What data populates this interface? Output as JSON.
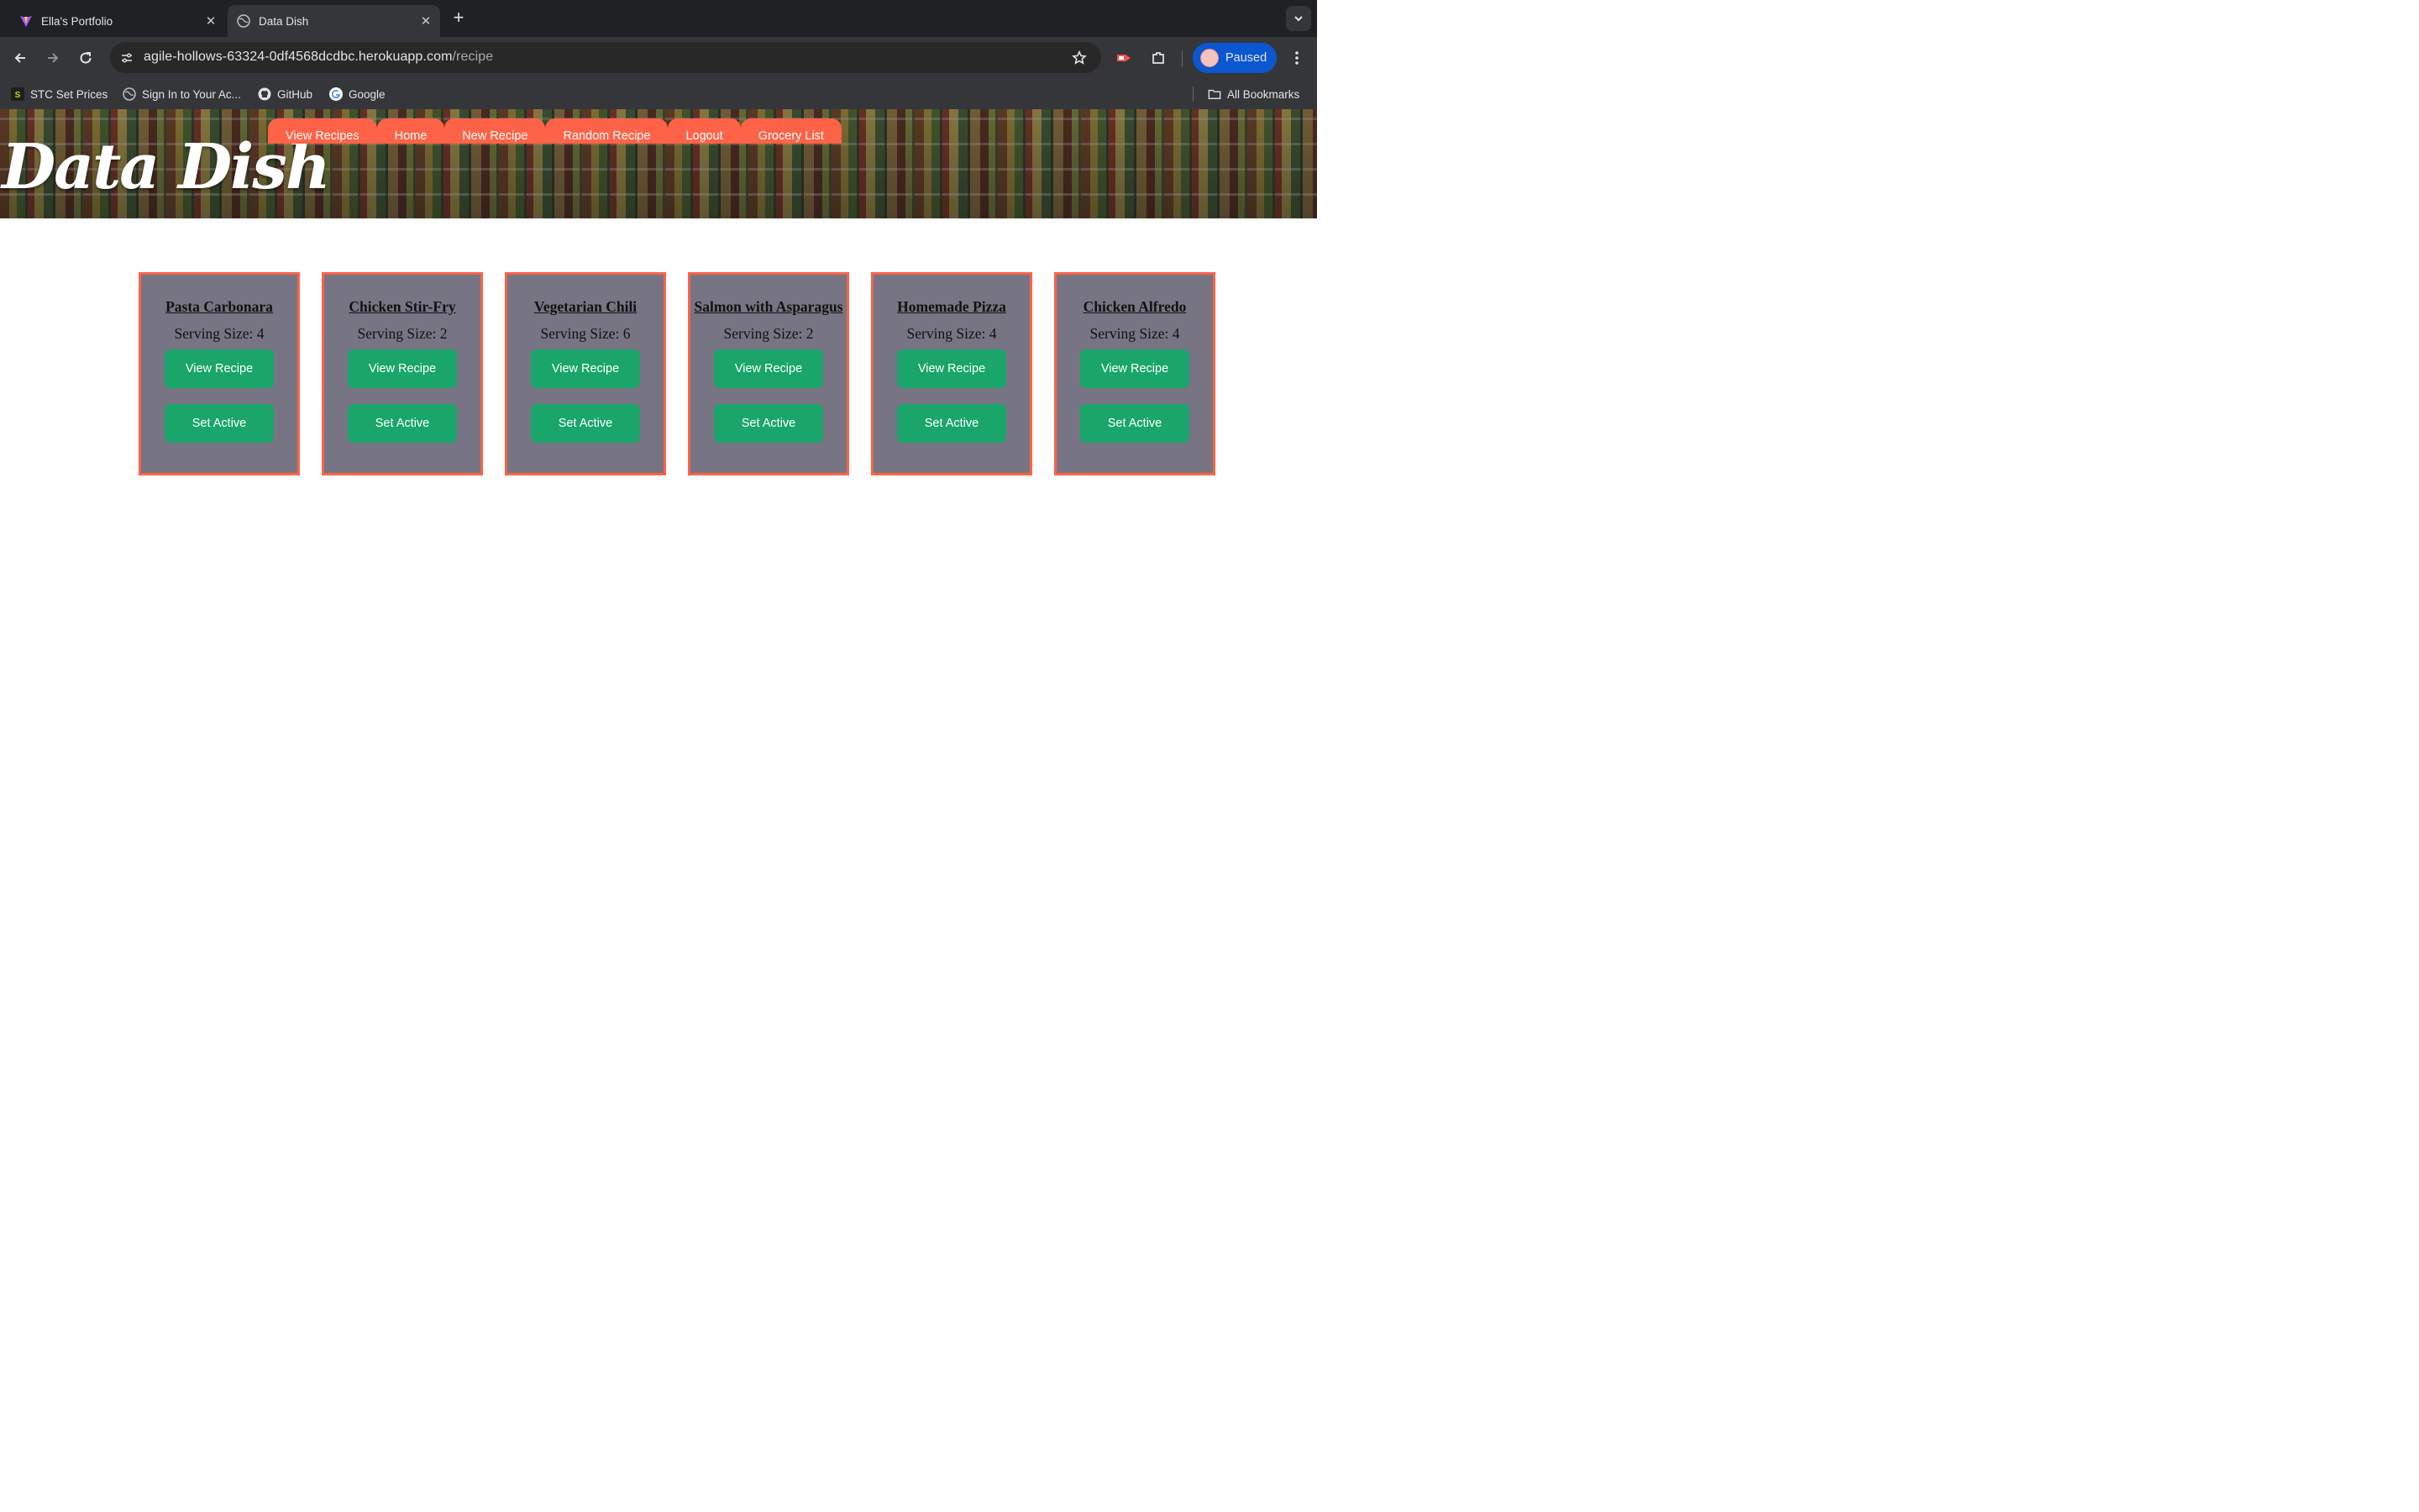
{
  "browser": {
    "tabs": [
      {
        "title": "Ella's Portfolio",
        "active": false,
        "favicon": "vite-logo-icon"
      },
      {
        "title": "Data Dish",
        "active": true,
        "favicon": "globe-icon"
      }
    ],
    "url_host": "agile-hollows-63324-0df4568dcdbc.herokuapp.com",
    "url_path": "/recipe",
    "profile_status": "Paused",
    "bookmarks": [
      {
        "label": "STC Set Prices",
        "icon": "s-logo-icon"
      },
      {
        "label": "Sign In to Your Ac...",
        "icon": "globe-icon"
      },
      {
        "label": "GitHub",
        "icon": "github-icon"
      },
      {
        "label": "Google",
        "icon": "google-icon"
      }
    ],
    "all_bookmarks": "All Bookmarks"
  },
  "site": {
    "brand": "Data Dish",
    "nav": [
      "View Recipes",
      "Home",
      "New Recipe",
      "Random Recipe",
      "Logout",
      "Grocery List"
    ]
  },
  "recipes": [
    {
      "name": "Pasta Carbonara",
      "serving": "Serving Size: 4",
      "view": "View Recipe",
      "set_active": "Set Active"
    },
    {
      "name": "Chicken Stir-Fry",
      "serving": "Serving Size: 2",
      "view": "View Recipe",
      "set_active": "Set Active"
    },
    {
      "name": "Vegetarian Chili",
      "serving": "Serving Size: 6",
      "view": "View Recipe",
      "set_active": "Set Active"
    },
    {
      "name": "Salmon with Asparagus",
      "serving": "Serving Size: 2",
      "view": "View Recipe",
      "set_active": "Set Active"
    },
    {
      "name": "Homemade Pizza",
      "serving": "Serving Size: 4",
      "view": "View Recipe",
      "set_active": "Set Active"
    },
    {
      "name": "Chicken Alfredo",
      "serving": "Serving Size: 4",
      "view": "View Recipe",
      "set_active": "Set Active"
    }
  ],
  "colors": {
    "accent": "#ff6347",
    "button": "#1aa56b",
    "card": "#777583",
    "chrome_dark": "#202124",
    "chrome_toolbar": "#35363a",
    "profile": "#0b57d0"
  }
}
